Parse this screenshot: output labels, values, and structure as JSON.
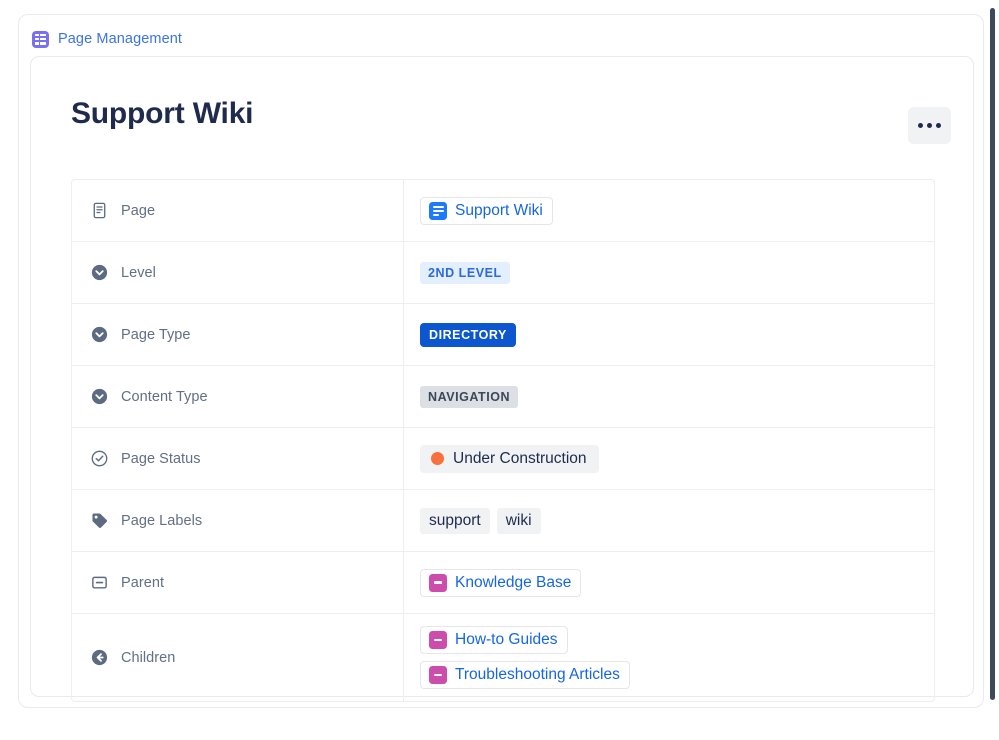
{
  "breadcrumb": {
    "icon": "table-grid-icon",
    "label": "Page Management"
  },
  "header": {
    "title": "Support Wiki",
    "more_button_label": "•••",
    "more_button_name": "more-actions-icon"
  },
  "colors": {
    "breadcrumb_icon": "#7a6ff0",
    "breadcrumb_text": "#3b73e8",
    "title": "#1e2b4d",
    "link": "#1666e4",
    "badge_blue_soft_bg": "#e3effd",
    "badge_blue_soft_text": "#2a6ade",
    "badge_blue_solid_bg": "#0c56d0",
    "badge_grey_bg": "#dcdfe4",
    "status_dot": "#f8713c",
    "chip_page_icon": "#1d7afc",
    "chip_folder_icon": "#cc4dab",
    "scrollbar": "#3d4a5c"
  },
  "properties": [
    {
      "key": "Page",
      "icon": "document-icon",
      "value_type": "link",
      "links": [
        {
          "text": "Support Wiki",
          "icon": "page-icon"
        }
      ]
    },
    {
      "key": "Level",
      "icon": "chevron-down-circle-icon",
      "value_type": "badge",
      "badges": [
        {
          "text": "2ND LEVEL",
          "style": "blue-soft"
        }
      ]
    },
    {
      "key": "Page Type",
      "icon": "chevron-down-circle-icon",
      "value_type": "badge",
      "badges": [
        {
          "text": "DIRECTORY",
          "style": "blue-solid"
        }
      ]
    },
    {
      "key": "Content Type",
      "icon": "chevron-down-circle-icon",
      "value_type": "badge",
      "badges": [
        {
          "text": "NAVIGATION",
          "style": "grey"
        }
      ]
    },
    {
      "key": "Page Status",
      "icon": "check-circle-icon",
      "value_type": "status",
      "status": {
        "text": "Under Construction",
        "dot_color": "#f8713c"
      }
    },
    {
      "key": "Page Labels",
      "icon": "tag-icon",
      "value_type": "labels",
      "labels": [
        "support",
        "wiki"
      ]
    },
    {
      "key": "Parent",
      "icon": "square-dash-icon",
      "value_type": "link",
      "links": [
        {
          "text": "Knowledge Base",
          "icon": "folder-icon"
        }
      ]
    },
    {
      "key": "Children",
      "icon": "arrow-left-circle-icon",
      "value_type": "link-stack",
      "links": [
        {
          "text": "How-to Guides",
          "icon": "folder-icon"
        },
        {
          "text": "Troubleshooting Articles",
          "icon": "folder-icon"
        }
      ]
    }
  ]
}
